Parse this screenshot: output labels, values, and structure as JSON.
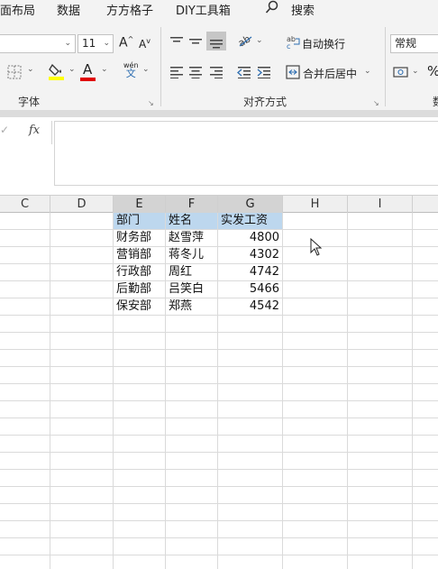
{
  "menu": {
    "tabs": [
      "面布局",
      "数据",
      "方方格子",
      "DIY工具箱"
    ],
    "search_label": "搜索"
  },
  "ribbon": {
    "font_size": "11",
    "grow_font": "A",
    "shrink_font": "A",
    "font_color_letter": "A",
    "phonetic_top": "wén",
    "phonetic_bottom": "文",
    "wrap_text": "自动换行",
    "merge_center": "合并后居中",
    "number_format": "常规",
    "percent": "%",
    "group_font": "字体",
    "group_alignment": "对齐方式",
    "group_number": "数",
    "colors": {
      "fill": "#ffff00",
      "font": "#e00000"
    }
  },
  "formula_bar": {
    "fx_label": "fx",
    "cancel_glyph": "✓"
  },
  "grid": {
    "columns": [
      "C",
      "D",
      "E",
      "F",
      "G",
      "H",
      "I"
    ],
    "header_row": [
      "部门",
      "姓名",
      "实发工资"
    ],
    "rows": [
      {
        "dept": "财务部",
        "name": "赵雪萍",
        "salary": "4800"
      },
      {
        "dept": "营销部",
        "name": "蒋冬儿",
        "salary": "4302"
      },
      {
        "dept": "行政部",
        "name": "周红",
        "salary": "4742"
      },
      {
        "dept": "后勤部",
        "name": "吕笑白",
        "salary": "5466"
      },
      {
        "dept": "保安部",
        "name": "郑燕",
        "salary": "4542"
      }
    ]
  }
}
